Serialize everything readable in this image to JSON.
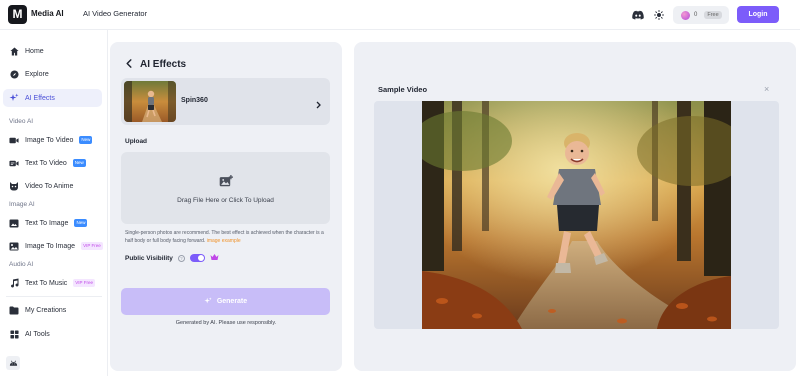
{
  "header": {
    "logo_letter": "M",
    "brand": "Media AI",
    "page_title": "AI Video Generator",
    "credits_count": "0",
    "credits_tag": "Free",
    "login_label": "Login",
    "icons": [
      "discord-icon",
      "sun-icon",
      "coin-icon"
    ]
  },
  "sidebar": {
    "items": [
      {
        "label": "Home",
        "icon": "home-icon"
      },
      {
        "label": "Explore",
        "icon": "compass-icon"
      },
      {
        "label": "AI Effects",
        "icon": "sparkles-icon",
        "active": true
      }
    ],
    "sections": [
      {
        "title": "Video AI",
        "items": [
          {
            "label": "Image To Video",
            "badge": "New",
            "icon": "image-video-icon"
          },
          {
            "label": "Text To Video",
            "badge": "New",
            "icon": "text-video-icon"
          },
          {
            "label": "Video To Anime",
            "icon": "anime-icon"
          }
        ]
      },
      {
        "title": "Image AI",
        "items": [
          {
            "label": "Text To Image",
            "badge": "New",
            "icon": "text-image-icon"
          },
          {
            "label": "Image To Image",
            "badge": "VIP Free",
            "icon": "image-image-icon"
          }
        ]
      },
      {
        "title": "Audio AI",
        "items": [
          {
            "label": "Text To Music",
            "badge": "VIP Free",
            "icon": "music-icon"
          }
        ]
      }
    ],
    "bottom_items": [
      {
        "label": "My Creations",
        "icon": "folder-icon"
      },
      {
        "label": "AI Tools",
        "icon": "grid-icon"
      }
    ],
    "footer_icon": "android-icon"
  },
  "left_panel": {
    "title": "AI Effects",
    "effect_name": "Spin360",
    "upload_label": "Upload",
    "upload_text": "Drag File Here or Click To Upload",
    "tip": "Single-person photos are recommend. The best effect is achieved when the character is a half body or full body facing forward.",
    "tip_link": "image example",
    "visibility_label": "Public Visibility",
    "visibility_on": true,
    "generate_label": "Generate",
    "generate_note": "Generated by AI. Please use responsibly."
  },
  "right_panel": {
    "title": "Sample Video",
    "close_label": "×"
  },
  "colors": {
    "accent": "#7c5cfa",
    "accent_disabled": "#c8bdf8",
    "panel_bg": "#eef0f5",
    "new_badge": "#3b8cff",
    "vip_badge_text": "#c048e8",
    "link": "#f0932b"
  }
}
